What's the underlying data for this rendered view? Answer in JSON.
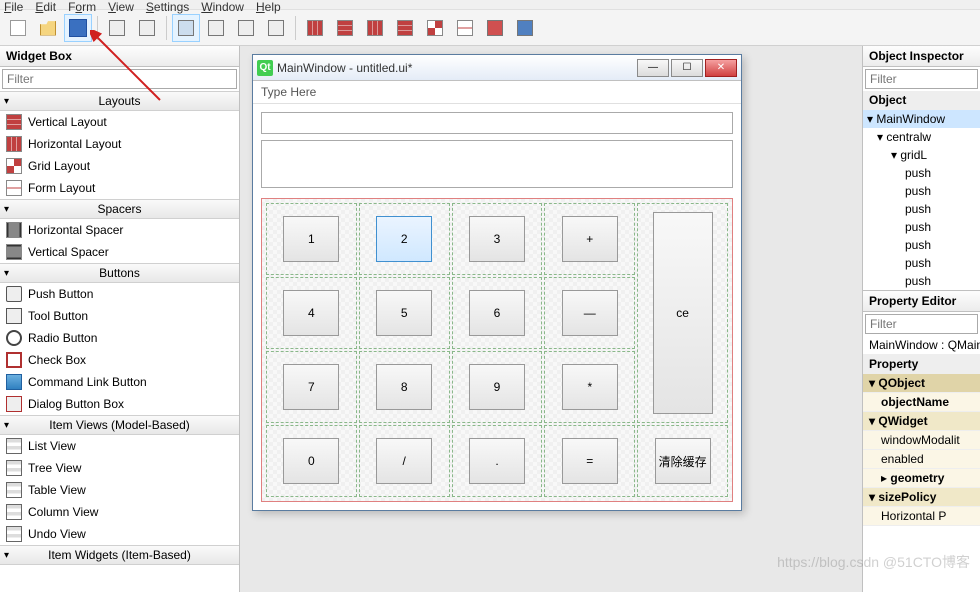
{
  "menubar": [
    "File",
    "Edit",
    "Form",
    "View",
    "Settings",
    "Window",
    "Help"
  ],
  "widget_box": {
    "title": "Widget Box",
    "filter": "Filter",
    "categories": [
      {
        "name": "Layouts",
        "items": [
          "Vertical Layout",
          "Horizontal Layout",
          "Grid Layout",
          "Form Layout"
        ]
      },
      {
        "name": "Spacers",
        "items": [
          "Horizontal Spacer",
          "Vertical Spacer"
        ]
      },
      {
        "name": "Buttons",
        "items": [
          "Push Button",
          "Tool Button",
          "Radio Button",
          "Check Box",
          "Command Link Button",
          "Dialog Button Box"
        ]
      },
      {
        "name": "Item Views (Model-Based)",
        "items": [
          "List View",
          "Tree View",
          "Table View",
          "Column View",
          "Undo View"
        ]
      },
      {
        "name": "Item Widgets (Item-Based)",
        "items": []
      }
    ]
  },
  "designer": {
    "title": "MainWindow - untitled.ui*",
    "menu_text": "Type Here",
    "buttons": [
      [
        "1",
        "2",
        "3",
        "+",
        "ce"
      ],
      [
        "4",
        "5",
        "6",
        "—",
        ""
      ],
      [
        "7",
        "8",
        "9",
        "*",
        ""
      ],
      [
        "0",
        "/",
        ".",
        "=",
        "清除缓存"
      ]
    ],
    "selected": "2"
  },
  "inspector": {
    "title": "Object Inspector",
    "filter": "Filter",
    "root": "Object",
    "tree": [
      "MainWindow",
      "centralw",
      "gridL",
      "push",
      "push",
      "push",
      "push",
      "push",
      "push",
      "push"
    ]
  },
  "properties": {
    "title": "Property Editor",
    "filter": "Filter",
    "context": "MainWindow : QMainW",
    "header": "Property",
    "groups": [
      {
        "cat": "QObject",
        "rows": [
          "objectName"
        ]
      },
      {
        "cat": "QWidget",
        "rows": [
          "windowModalit",
          "enabled",
          "geometry",
          "sizePolicy",
          "Horizontal P"
        ]
      }
    ]
  },
  "watermark": "https://blog.csdn @51CTO博客"
}
